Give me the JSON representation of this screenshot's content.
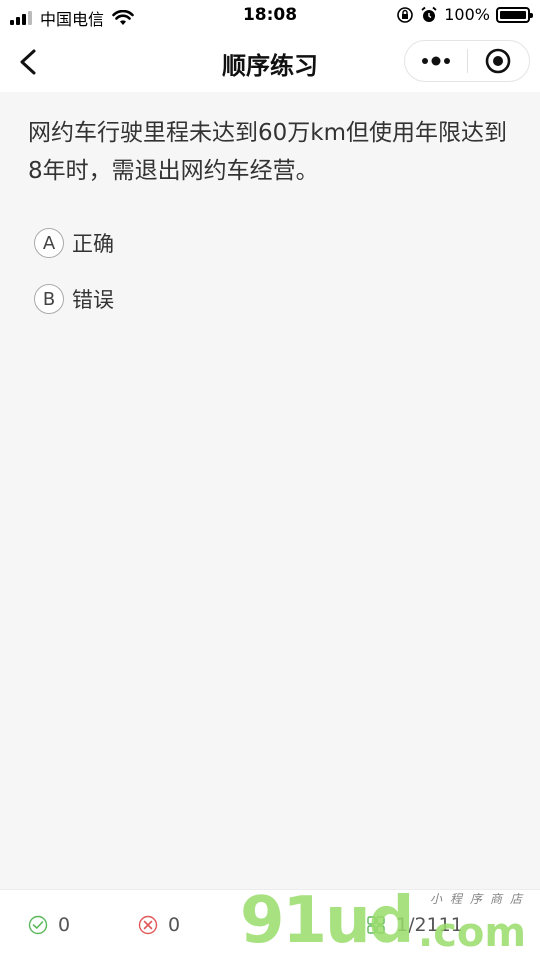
{
  "status_bar": {
    "carrier": "中国电信",
    "time": "18:08",
    "battery": "100%"
  },
  "nav": {
    "title": "顺序练习"
  },
  "question": {
    "text": "网约车行驶里程未达到60万km但使用年限达到8年时，需退出网约车经营。",
    "options": [
      {
        "letter": "A",
        "label": "正确"
      },
      {
        "letter": "B",
        "label": "错误"
      }
    ]
  },
  "bottom_bar": {
    "correct_count": "0",
    "wrong_count": "0",
    "progress": "1/2111"
  },
  "watermark": {
    "brand": "91ud",
    "suffix": ".com",
    "subtitle": "小程序商店"
  },
  "colors": {
    "background": "#f6f6f6",
    "correct": "#5cb85c",
    "wrong": "#e05a5a",
    "watermark": "#98dc6a"
  },
  "icons": {
    "back": "chevron-left-icon",
    "more": "more-dots-icon",
    "close": "target-circle-icon",
    "correct": "check-circle-icon",
    "wrong": "x-circle-icon",
    "progress": "grid-icon"
  }
}
